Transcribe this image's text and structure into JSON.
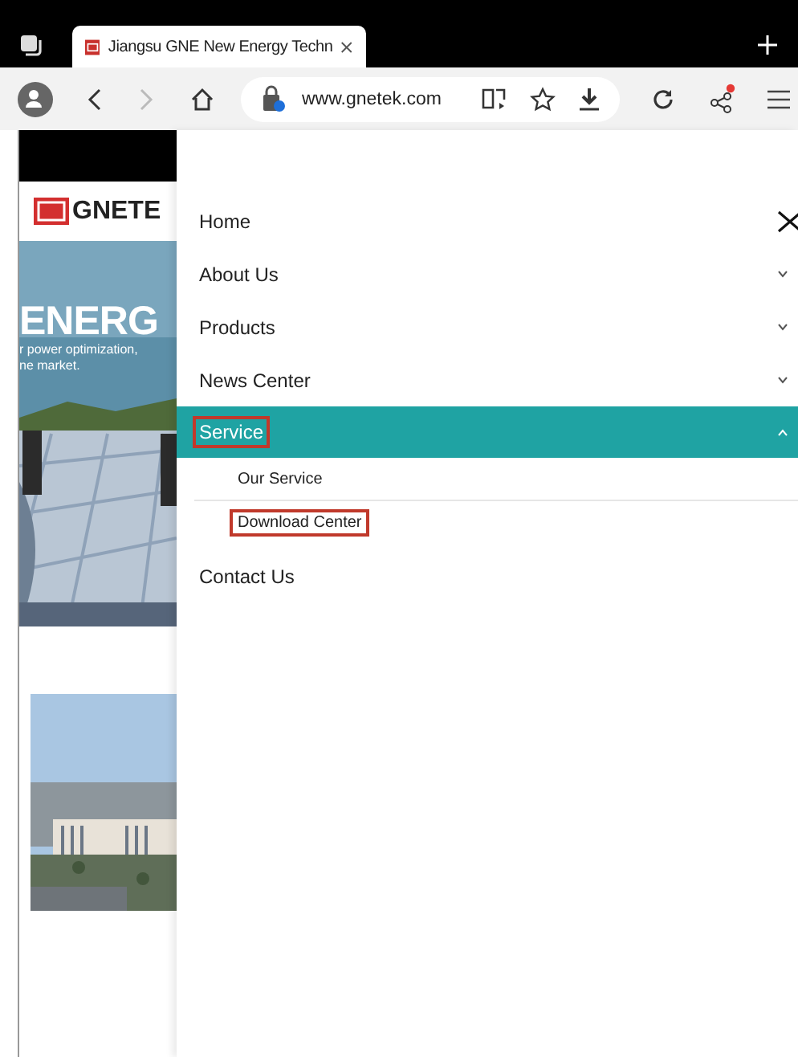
{
  "browser": {
    "tab": {
      "title": "Jiangsu GNE New Energy Techn"
    },
    "url": "www.gnetek.com",
    "share_notification": true
  },
  "page": {
    "logo": "GNETE",
    "hero": {
      "headline": "ENERG",
      "lines": [
        "r power optimization,",
        "ne market."
      ]
    }
  },
  "menu": {
    "items": [
      {
        "label": "Home",
        "kind": "link",
        "outlined": false
      },
      {
        "label": "About Us",
        "kind": "dropdown",
        "expanded": false,
        "outlined": false
      },
      {
        "label": "Products",
        "kind": "dropdown",
        "expanded": false,
        "outlined": false
      },
      {
        "label": "News Center",
        "kind": "dropdown",
        "expanded": false,
        "outlined": false
      },
      {
        "label": "Service",
        "kind": "dropdown",
        "expanded": true,
        "outlined": true,
        "children": [
          {
            "label": "Our Service",
            "outlined": false
          },
          {
            "label": "Download Center",
            "outlined": true
          }
        ]
      },
      {
        "label": "Contact Us",
        "kind": "link",
        "outlined": false
      }
    ]
  }
}
